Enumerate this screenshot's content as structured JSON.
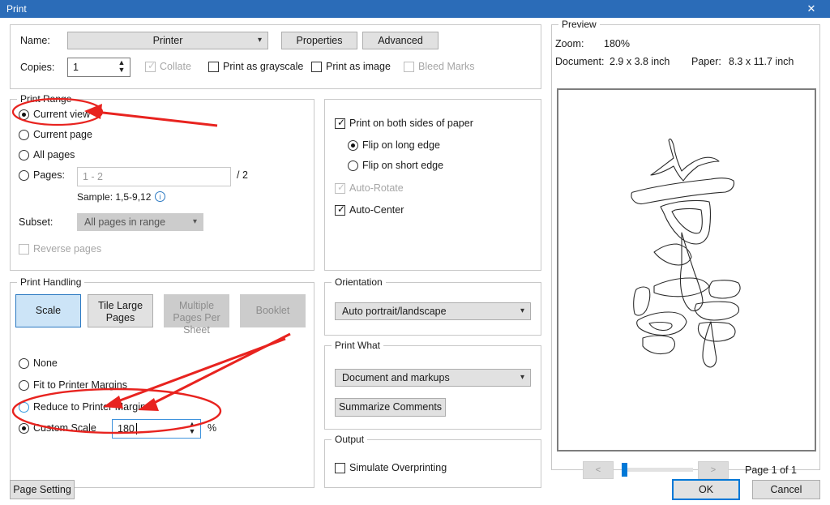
{
  "window": {
    "title": "Print",
    "close_icon": "close-icon",
    "titlebar_color": "#2b6cb8"
  },
  "printer": {
    "name_label": "Name:",
    "name_value": "Printer",
    "properties_button": "Properties",
    "advanced_button": "Advanced",
    "copies_label": "Copies:",
    "copies_value": "1",
    "collate_label": "Collate",
    "collate_checked": true,
    "collate_disabled": true,
    "grayscale_label": "Print as grayscale",
    "grayscale_checked": false,
    "print_as_image_label": "Print as image",
    "print_as_image_checked": false,
    "bleed_marks_label": "Bleed Marks",
    "bleed_marks_checked": false,
    "bleed_marks_disabled": true
  },
  "print_range": {
    "legend": "Print Range",
    "options": [
      {
        "label": "Current view",
        "selected": true
      },
      {
        "label": "Current page",
        "selected": false
      },
      {
        "label": "All pages",
        "selected": false
      },
      {
        "label": "Pages:",
        "selected": false
      }
    ],
    "pages_placeholder": "1 - 2",
    "pages_total": "/ 2",
    "sample_text": "Sample: 1,5-9,12",
    "info_icon": "info-icon",
    "subset_label": "Subset:",
    "subset_value": "All pages in range",
    "reverse_pages_label": "Reverse pages",
    "reverse_pages_checked": false
  },
  "duplex": {
    "both_sides_label": "Print on both sides of paper",
    "both_sides_checked": true,
    "flip_long_label": "Flip on long edge",
    "flip_long_selected": true,
    "flip_short_label": "Flip on short edge",
    "flip_short_selected": false,
    "auto_rotate_label": "Auto-Rotate",
    "auto_rotate_checked": true,
    "auto_rotate_disabled": true,
    "auto_center_label": "Auto-Center",
    "auto_center_checked": true
  },
  "print_handling": {
    "legend": "Print Handling",
    "tabs": [
      {
        "label": "Scale",
        "selected": true,
        "disabled": false
      },
      {
        "label": "Tile Large Pages",
        "selected": false,
        "disabled": false
      },
      {
        "label": "Multiple Pages Per Sheet",
        "selected": false,
        "disabled": true
      },
      {
        "label": "Booklet",
        "selected": false,
        "disabled": true
      }
    ],
    "scale_options": [
      {
        "label": "None",
        "selected": false
      },
      {
        "label": "Fit to Printer Margins",
        "selected": false
      },
      {
        "label": "Reduce to Printer Margins",
        "selected": false
      },
      {
        "label": "Custom Scale",
        "selected": true
      }
    ],
    "custom_scale_value": "180",
    "percent_symbol": "%"
  },
  "orientation": {
    "legend": "Orientation",
    "value": "Auto portrait/landscape"
  },
  "print_what": {
    "legend": "Print What",
    "value": "Document and markups",
    "summarize_button": "Summarize Comments"
  },
  "output": {
    "legend": "Output",
    "simulate_overprinting_label": "Simulate Overprinting",
    "simulate_overprinting_checked": false
  },
  "preview": {
    "legend": "Preview",
    "zoom_label": "Zoom:",
    "zoom_value": "180%",
    "document_label": "Document:",
    "document_value": "2.9 x 3.8 inch",
    "paper_label": "Paper:",
    "paper_value": "8.3 x 11.7 inch",
    "page_indicator": "Page 1 of 1",
    "prev_button": "<",
    "next_button": ">",
    "content_description": "Chinese calligraphy outline characters"
  },
  "footer": {
    "page_setting_button": "Page Setting",
    "ok_button": "OK",
    "cancel_button": "Cancel"
  },
  "annotations": {
    "color": "#e8231f",
    "marks": [
      "ellipse-around-current-view",
      "arrow-to-current-view",
      "ellipse-around-custom-scale",
      "arrow-to-custom-scale-radio",
      "arrow-to-custom-scale-input"
    ]
  }
}
